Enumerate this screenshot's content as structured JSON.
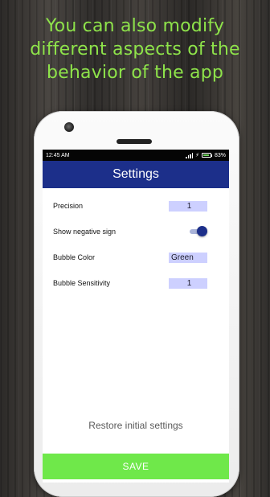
{
  "promo": {
    "line1": "You can also modify",
    "line2": "different aspects of the",
    "line3": "behavior of the app"
  },
  "status_bar": {
    "time": "12:45 AM",
    "battery": "83%",
    "icons": [
      "signal-icon",
      "charging-icon",
      "battery-icon"
    ]
  },
  "app_bar": {
    "title": "Settings"
  },
  "settings": {
    "precision": {
      "label": "Precision",
      "value": "1"
    },
    "negative_sign": {
      "label": "Show negative sign",
      "enabled": true
    },
    "bubble_color": {
      "label": "Bubble Color",
      "value": "Green"
    },
    "bubble_sensitivity": {
      "label": "Bubble Sensitivity",
      "value": "1"
    }
  },
  "actions": {
    "restore": "Restore initial settings",
    "save": "SAVE"
  },
  "colors": {
    "promo_text": "#8ee34a",
    "app_bar": "#1c2f8a",
    "field_background": "#cdd0ff",
    "save_button": "#6fe84a"
  }
}
